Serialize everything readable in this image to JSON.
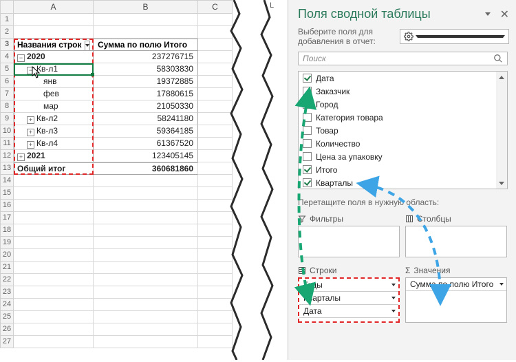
{
  "sheet": {
    "columns": [
      "A",
      "B",
      "C",
      "L"
    ],
    "header": {
      "rowlabel": "Названия строк",
      "value": "Сумма по полю Итого"
    },
    "rows": [
      {
        "num": 1
      },
      {
        "num": 2
      },
      {
        "num": 3,
        "type": "header"
      },
      {
        "num": 4,
        "label": "2020",
        "exp": "-",
        "indent": 0,
        "value": "237276715"
      },
      {
        "num": 5,
        "label": "Кв-л1",
        "exp": "-",
        "indent": 1,
        "value": "58303830",
        "selected": true
      },
      {
        "num": 6,
        "label": "янв",
        "indent": 2,
        "value": "19372885"
      },
      {
        "num": 7,
        "label": "фев",
        "indent": 2,
        "value": "17880615"
      },
      {
        "num": 8,
        "label": "мар",
        "indent": 2,
        "value": "21050330"
      },
      {
        "num": 9,
        "label": "Кв-л2",
        "exp": "+",
        "indent": 1,
        "value": "58241180"
      },
      {
        "num": 10,
        "label": "Кв-л3",
        "exp": "+",
        "indent": 1,
        "value": "59364185"
      },
      {
        "num": 11,
        "label": "Кв-л4",
        "exp": "+",
        "indent": 1,
        "value": "61367520"
      },
      {
        "num": 12,
        "label": "2021",
        "exp": "+",
        "indent": 0,
        "value": "123405145"
      },
      {
        "num": 13,
        "label": "Общий итог",
        "type": "total",
        "value": "360681860"
      },
      {
        "num": 14
      },
      {
        "num": 15
      },
      {
        "num": 16
      },
      {
        "num": 17
      },
      {
        "num": 18
      },
      {
        "num": 19
      },
      {
        "num": 20
      },
      {
        "num": 21
      },
      {
        "num": 22
      },
      {
        "num": 23
      },
      {
        "num": 24
      },
      {
        "num": 25
      },
      {
        "num": 26
      },
      {
        "num": 27
      }
    ]
  },
  "pane": {
    "title": "Поля сводной таблицы",
    "subtitle": "Выберите поля для добавления в отчет:",
    "search_placeholder": "Поиск",
    "fields": [
      {
        "name": "Дата",
        "checked": true
      },
      {
        "name": "Заказчик",
        "checked": false
      },
      {
        "name": "Город",
        "checked": false
      },
      {
        "name": "Категория товара",
        "checked": false
      },
      {
        "name": "Товар",
        "checked": false
      },
      {
        "name": "Количество",
        "checked": false
      },
      {
        "name": "Цена за упаковку",
        "checked": false
      },
      {
        "name": "Итого",
        "checked": true
      },
      {
        "name": "Кварталы",
        "checked": true
      }
    ],
    "drag_prompt": "Перетащите поля в нужную область:",
    "zone_filters": "Фильтры",
    "zone_columns": "Столбцы",
    "zone_rows": "Строки",
    "zone_values": "Значения",
    "rows_items": [
      "Годы",
      "Кварталы",
      "Дата"
    ],
    "values_items": [
      "Сумма по полю Итого"
    ]
  },
  "tear_label_left": "L",
  "sigma": "Σ"
}
